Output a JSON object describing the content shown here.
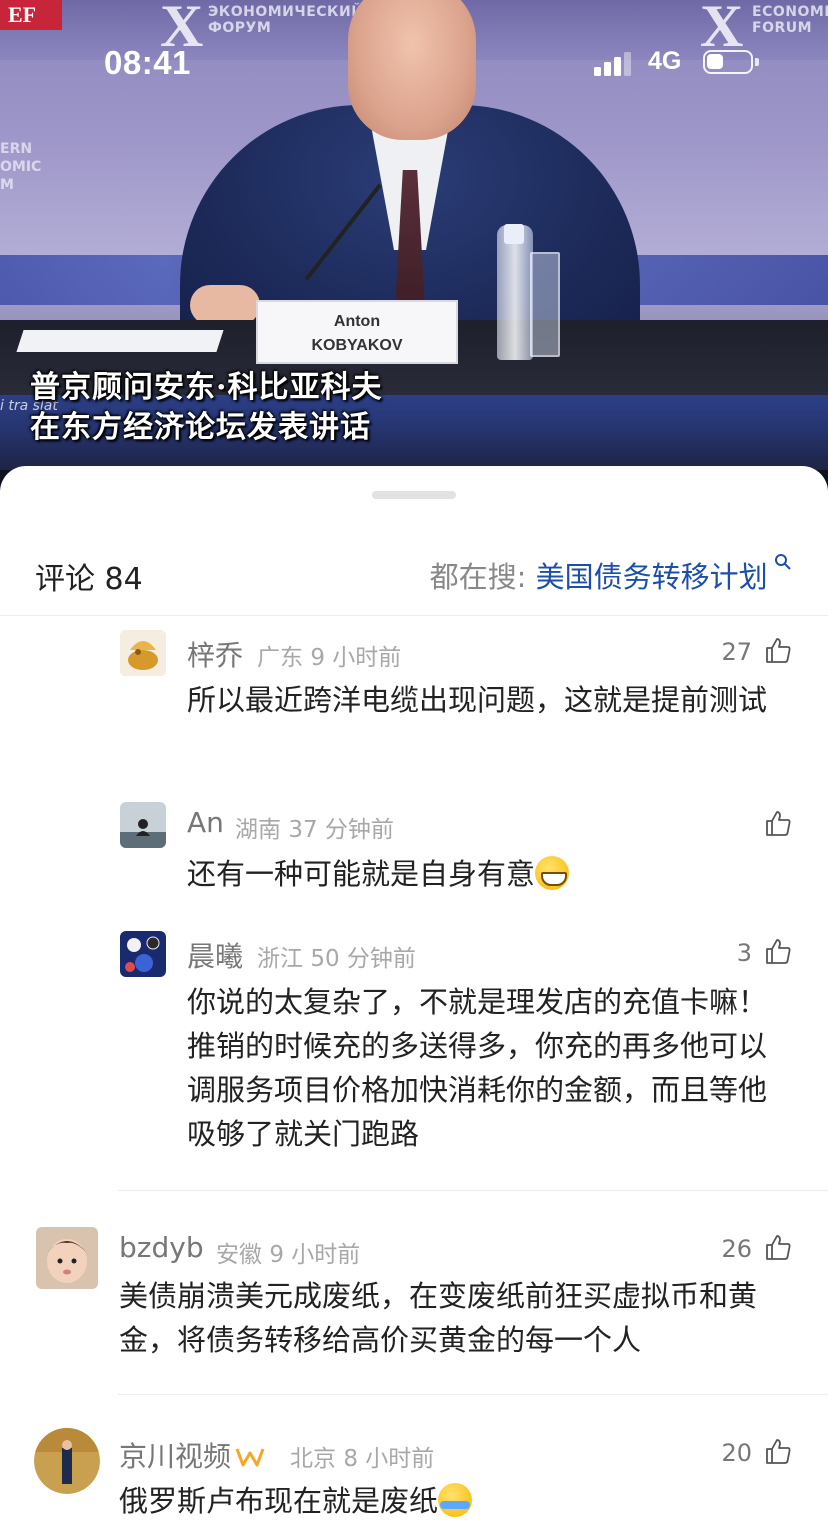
{
  "status_bar": {
    "time": "08:41",
    "network": "4G",
    "signal_bars": 3,
    "battery_level": 0.4
  },
  "video": {
    "subtitle_line1": "普京顾问安东·科比亚科夫",
    "subtitle_line2": "在东方经济论坛发表讲话",
    "nameplate_line1": "Anton",
    "nameplate_line2": "KOBYAKOV",
    "backdrop_text_left": "ЭКОНОМИЧЕСКИЙ\nФОРУМ",
    "backdrop_text_right": "ECONOMIC\nFORUM",
    "backdrop_x": "X",
    "logo_letters": "EF",
    "side_text": "ERN\nOMIC\nM",
    "translation_fragment": "i tra slat"
  },
  "comments_sheet": {
    "title": "评论 84",
    "hot_search_prefix": "都在搜: ",
    "hot_search_term": "美国债务转移计划",
    "hot_search_icon": "search-icon"
  },
  "comments": [
    {
      "name": "梓乔",
      "region": "广东",
      "time": "9 小时前",
      "likes": "27",
      "text": "所以最近跨洋电缆出现问题，这就是提前测试",
      "reply": true
    },
    {
      "name": "An",
      "region": "湖南",
      "time": "37 分钟前",
      "likes": "",
      "text": "还有一种可能就是自身有意",
      "emoji": "grin-emoji",
      "reply": true
    },
    {
      "name": "晨曦",
      "region": "浙江",
      "time": "50 分钟前",
      "likes": "3",
      "text": "你说的太复杂了，不就是理发店的充值卡嘛！推销的时候充的多送得多，你充的再多他可以调服务项目价格加快消耗你的金额，而且等他吸够了就关门跑路",
      "reply": true
    },
    {
      "name": "bzdyb",
      "region": "安徽",
      "time": "9 小时前",
      "likes": "26",
      "text": "美债崩溃美元成废纸，在变废纸前狂买虚拟币和黄金，将债务转移给高价买黄金的每一个人",
      "reply": false
    },
    {
      "name": "京川视频",
      "region": "北京",
      "time": "8 小时前",
      "likes": "20",
      "text": "俄罗斯卢布现在就是废纸",
      "emoji": "crying-laughing-emoji",
      "badge": "weibo-badge",
      "reply": false
    }
  ],
  "colors": {
    "link_blue": "#1d4fa8",
    "name_gray": "#777777",
    "meta_gray": "#a8a8a8",
    "text_dark": "#222222",
    "badge_orange": "#f5a623"
  }
}
